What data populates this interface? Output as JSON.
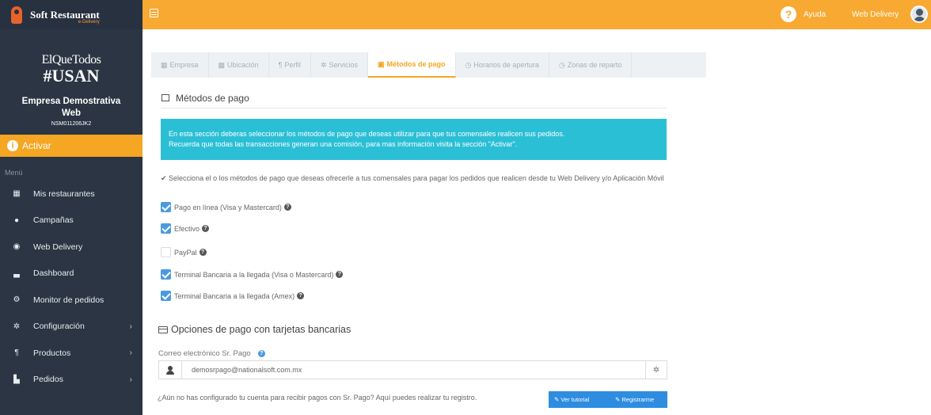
{
  "brand": {
    "name": "Soft Restaurant",
    "sub": "e-Delivery"
  },
  "slogan": {
    "line1": "ElQueTodos",
    "line2": "#USAN"
  },
  "company": {
    "name_line1": "Empresa Demostrativa",
    "name_line2": "Web",
    "id": "NSM011206JK2"
  },
  "sidebar": {
    "activate_label": "Activar",
    "menu_label": "Menú",
    "items": [
      {
        "label": "Mis restaurantes",
        "icon": "grid-icon",
        "chevron": false
      },
      {
        "label": "Campañas",
        "icon": "dot-icon",
        "chevron": false
      },
      {
        "label": "Web Delivery",
        "icon": "globe-icon",
        "chevron": false
      },
      {
        "label": "Dashboard",
        "icon": "chart-icon",
        "chevron": false
      },
      {
        "label": "Monitor de pedidos",
        "icon": "bike-icon",
        "chevron": false
      },
      {
        "label": "Configuración",
        "icon": "gear-icon",
        "chevron": true
      },
      {
        "label": "Productos",
        "icon": "cutlery-icon",
        "chevron": true
      },
      {
        "label": "Pedidos",
        "icon": "bars-icon",
        "chevron": true
      }
    ]
  },
  "topbar": {
    "help_label": "Ayuda",
    "user_label": "Web Delivery"
  },
  "tabs": [
    {
      "label": "Empresa",
      "icon": "building-icon",
      "active": false
    },
    {
      "label": "Ubicación",
      "icon": "map-icon",
      "active": false
    },
    {
      "label": "Perfil",
      "icon": "cutlery-icon",
      "active": false
    },
    {
      "label": "Servicios",
      "icon": "gears-icon",
      "active": false
    },
    {
      "label": "Métodos de pago",
      "icon": "money-icon",
      "active": true
    },
    {
      "label": "Horarios de apertura",
      "icon": "clock-icon",
      "active": false
    },
    {
      "label": "Zonas de reparto",
      "icon": "clock-icon",
      "active": false
    }
  ],
  "section": {
    "title": "Métodos de pago",
    "info_line1": "En esta sección deberas seleccionar los métodos de pago que deseas utilizar para que tus comensales realicen sus pedidos.",
    "info_line2": "Recuerda que todas las transacciones generan una comisión, para mas información visita la sección \"Activar\".",
    "note": "Selecciona el o los métodos de pago que deseas ofrecerle a tus comensales para pagar los pedidos que realicen desde tu Web Delivery y/o Aplicación Móvil"
  },
  "options": [
    {
      "label": "Pago en línea (Visa y Mastercard)",
      "checked": true
    },
    {
      "label": "Efectivo",
      "checked": true
    },
    {
      "label": "PayPal",
      "checked": false
    },
    {
      "label": "Terminal Bancaria a la llegada (Visa o Mastercard)",
      "checked": true
    },
    {
      "label": "Terminal Bancaria a la llegada (Amex)",
      "checked": true
    }
  ],
  "cards": {
    "title": "Opciones de pago con tarjetas bancarias",
    "email_label": "Correo electrónico Sr. Pago",
    "email_value": "demosrpago@nationalsoft.com.mx",
    "register_question": "¿Aún no has configurado tu cuenta para recibir pagos con Sr. Pago? Aquí puedes realizar tu registro.",
    "tutorial_button": "Ver tutorial",
    "register_button": "Registrarme"
  },
  "colors": {
    "accent": "#f7a932",
    "sidebar": "#2b3543",
    "info": "#2bbfd6",
    "button": "#2e8de0",
    "checkbox": "#4b9ae1"
  }
}
